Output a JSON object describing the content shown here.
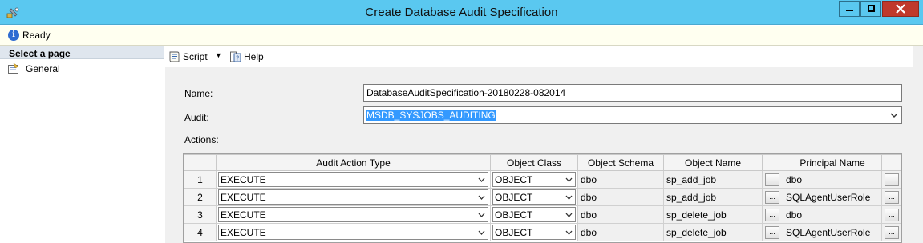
{
  "window": {
    "title": "Create Database Audit Specification",
    "controls": {
      "minimize": "minimize-icon",
      "maximize": "maximize-icon",
      "close": "close-icon"
    }
  },
  "status": {
    "icon": "info-icon",
    "text": "Ready"
  },
  "sidebar": {
    "header": "Select a page",
    "items": [
      {
        "label": "General",
        "icon": "general-page-icon"
      }
    ]
  },
  "toolbar": {
    "script_label": "Script",
    "help_label": "Help"
  },
  "form": {
    "name_label": "Name:",
    "name_value": "DatabaseAuditSpecification-20180228-082014",
    "audit_label": "Audit:",
    "audit_value": "MSDB_SYSJOBS_AUDITING",
    "actions_label": "Actions:"
  },
  "grid": {
    "columns": [
      "",
      "Audit Action Type",
      "Object Class",
      "Object Schema",
      "Object Name",
      "",
      "Principal Name",
      ""
    ],
    "rows": [
      {
        "num": "1",
        "action": "EXECUTE",
        "class": "OBJECT",
        "schema": "dbo",
        "name": "sp_add_job",
        "principal": "dbo"
      },
      {
        "num": "2",
        "action": "EXECUTE",
        "class": "OBJECT",
        "schema": "dbo",
        "name": "sp_add_job",
        "principal": "SQLAgentUserRole"
      },
      {
        "num": "3",
        "action": "EXECUTE",
        "class": "OBJECT",
        "schema": "dbo",
        "name": "sp_delete_job",
        "principal": "dbo"
      },
      {
        "num": "4",
        "action": "EXECUTE",
        "class": "OBJECT",
        "schema": "dbo",
        "name": "sp_delete_job",
        "principal": "SQLAgentUserRole"
      }
    ],
    "ellipsis": "..."
  },
  "colors": {
    "titlebar": "#5ac8f0",
    "statusbar": "#fffff0",
    "selection": "#3399ff",
    "close_button": "#c0392b"
  }
}
